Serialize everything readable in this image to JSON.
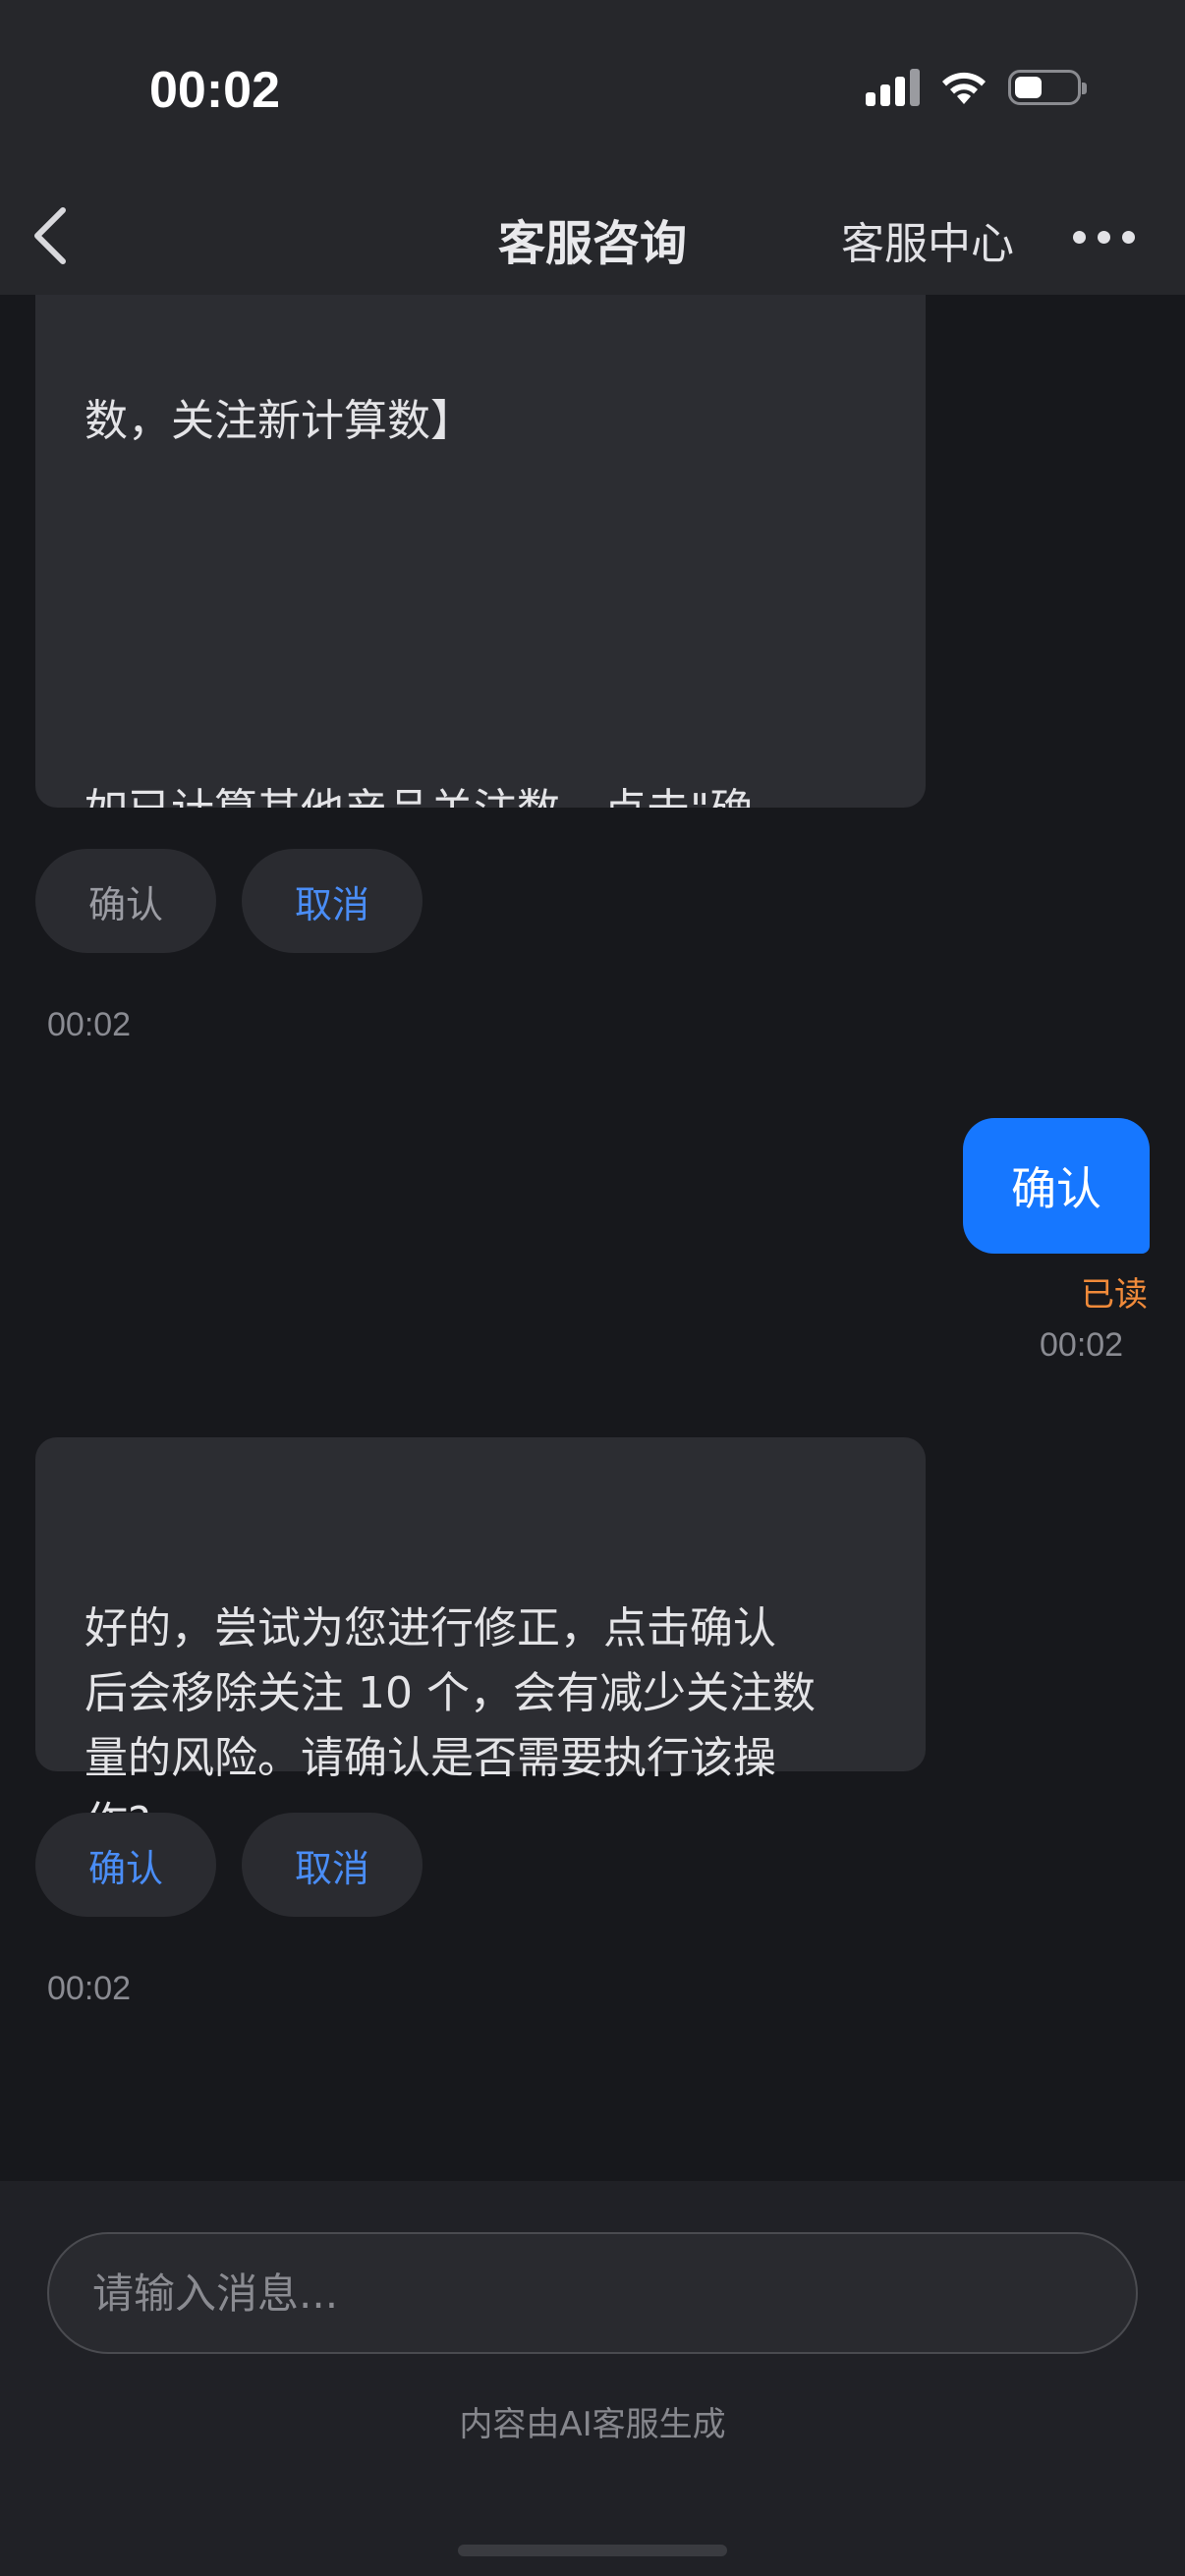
{
  "status_bar": {
    "time": "00:02",
    "battery_level": 0.45
  },
  "nav": {
    "title": "客服咨询",
    "link": "客服中心",
    "back_icon": "chevron-left-icon",
    "more_icon": "more-horizontal-icon"
  },
  "messages": {
    "bot1": {
      "partial_top": "数，关注新计算数】",
      "text": "如已计算其他产品关注数，点击\"确\n认\"即可进行修正。系统将保留有效关\n注，自动取关无效用户及话题/超话等\n非用户类关注，关注数会相应减少，\n部分此前未展示的正常用户将重新显\n示。",
      "confirm_label": "确认",
      "cancel_label": "取消",
      "time": "00:02"
    },
    "user1": {
      "text": "确认",
      "status": "已读",
      "time": "00:02"
    },
    "bot2": {
      "text": "好的，尝试为您进行修正，点击确认\n后会移除关注 10 个，会有减少关注数\n量的风险。请确认是否需要执行该操\n作?",
      "confirm_label": "确认",
      "cancel_label": "取消",
      "time": "00:02"
    }
  },
  "composer": {
    "placeholder": "请输入消息...",
    "disclaimer": "内容由AI客服生成"
  },
  "colors": {
    "background": "#17181c",
    "header": "#26272b",
    "bubble_in": "#2c2d32",
    "bubble_out": "#1677ff",
    "link_blue": "#4a8df6",
    "read_orange": "#f08a3a"
  }
}
